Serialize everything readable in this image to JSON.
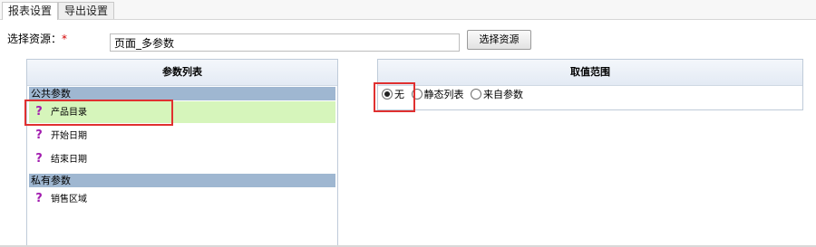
{
  "tabs": [
    {
      "label": "报表设置"
    },
    {
      "label": "导出设置"
    }
  ],
  "resource": {
    "label": "选择资源：",
    "required_mark": "*",
    "value": "页面_多参数",
    "button": "选择资源"
  },
  "param_panel": {
    "title": "参数列表",
    "groups": [
      {
        "name": "公共参数",
        "items": [
          "产品目录",
          "开始日期",
          "结束日期"
        ]
      },
      {
        "name": "私有参数",
        "items": [
          "销售区域"
        ]
      }
    ],
    "selected": "产品目录",
    "item_icon": "question-mark-icon"
  },
  "range_panel": {
    "title": "取值范围",
    "options": [
      "无",
      "静态列表",
      "来自参数"
    ],
    "selected": "无"
  },
  "colors": {
    "group_header": "#9fb7d1",
    "selected_row": "#d6f5bb",
    "highlight_box": "#e03030",
    "question_icon": "#a21caf"
  }
}
